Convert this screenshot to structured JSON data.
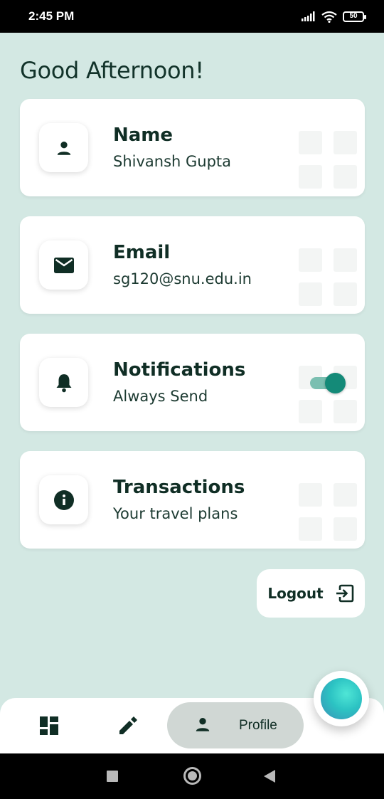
{
  "status_bar": {
    "time": "2:45 PM",
    "battery": "50"
  },
  "greeting": "Good Afternoon!",
  "cards": [
    {
      "title": "Name",
      "subtitle": "Shivansh Gupta",
      "icon": "person-icon"
    },
    {
      "title": "Email",
      "subtitle": "sg120@snu.edu.in",
      "icon": "mail-icon"
    },
    {
      "title": "Notifications",
      "subtitle": "Always Send",
      "icon": "bell-icon",
      "toggle_on": true
    },
    {
      "title": "Transactions",
      "subtitle": "Your travel plans",
      "icon": "info-icon"
    }
  ],
  "logout": {
    "label": "Logout"
  },
  "bottom_nav": {
    "items": [
      {
        "name": "dashboard",
        "icon": "dashboard-icon"
      },
      {
        "name": "edit",
        "icon": "pencil-icon"
      },
      {
        "name": "profile",
        "icon": "person-icon",
        "label": "Profile",
        "active": true
      }
    ]
  },
  "colors": {
    "background": "#d3e8e3",
    "card": "#ffffff",
    "text_dark": "#102e25",
    "toggle_accent": "#148a78",
    "nav_active_pill": "#d0d7d4"
  }
}
